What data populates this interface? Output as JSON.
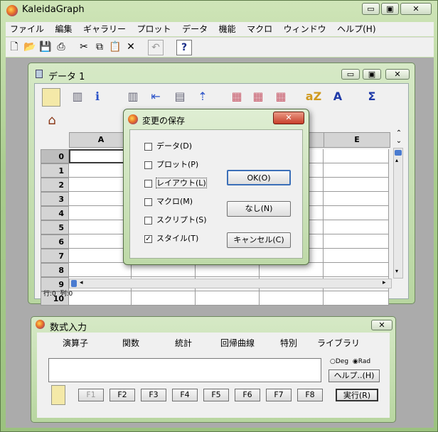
{
  "app": {
    "title": "KaleidaGraph",
    "minimize": "▭",
    "restore": "▣",
    "close": "✕"
  },
  "menu": [
    "ファイル",
    "編集",
    "ギャラリー",
    "プロット",
    "データ",
    "機能",
    "マクロ",
    "ウィンドウ",
    "ヘルプ(H)"
  ],
  "toolbar": {
    "help_label": "?"
  },
  "data_window": {
    "title": "データ 1",
    "minimize": "▭",
    "restore": "▣",
    "close": "✕",
    "columns": [
      "A",
      "",
      "",
      "",
      "E"
    ],
    "rows": [
      "0",
      "1",
      "2",
      "3",
      "4",
      "5",
      "6",
      "7",
      "8",
      "9",
      "10"
    ],
    "status_row": "行:0",
    "status_col": "列:0"
  },
  "dialog": {
    "title": "変更の保存",
    "close": "✕",
    "options": [
      {
        "label": "データ(D)",
        "checked": false
      },
      {
        "label": "プロット(P)",
        "checked": false
      },
      {
        "label": "レイアウト(L)",
        "checked": false
      },
      {
        "label": "マクロ(M)",
        "checked": false
      },
      {
        "label": "スクリプト(S)",
        "checked": false
      },
      {
        "label": "スタイル(T)",
        "checked": true
      }
    ],
    "ok_label": "OK(O)",
    "none_label": "なし(N)",
    "cancel_label": "キャンセル(C)"
  },
  "formula_window": {
    "title": "数式入力",
    "close": "✕",
    "tabs": [
      "演算子",
      "関数",
      "統計",
      "回帰曲線",
      "特別",
      "ライブラリ"
    ],
    "deg_label": "Deg",
    "rad_label": "Rad",
    "angle_mode": "Rad",
    "help_label": "ヘルプ..(H)",
    "fkeys": [
      "F1",
      "F2",
      "F3",
      "F4",
      "F5",
      "F6",
      "F7",
      "F8"
    ],
    "run_label": "実行(R)"
  }
}
